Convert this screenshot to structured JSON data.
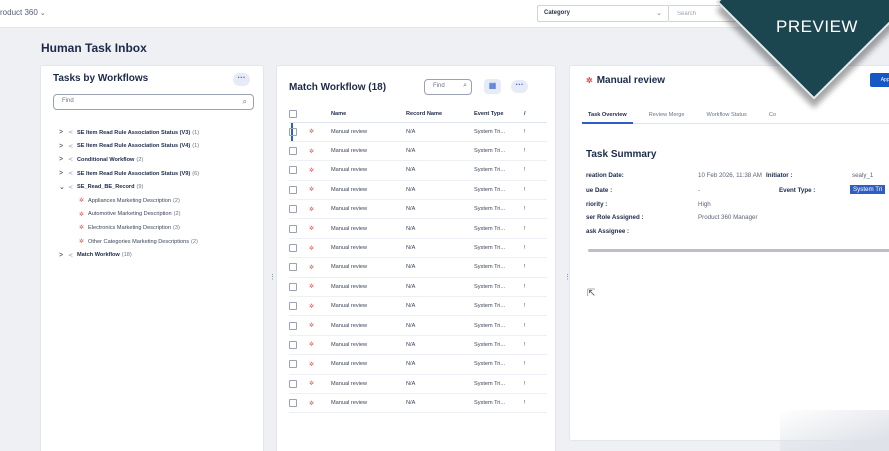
{
  "header": {
    "app_name": "roduct 360",
    "category_label": "Category",
    "search_placeholder": "Search"
  },
  "page_title": "Human Task Inbox",
  "left_panel": {
    "title": "Tasks by Workflows",
    "more_label": "···",
    "find_placeholder": "Find",
    "tree": [
      {
        "toggle": ">",
        "name": "SE Item Read Rule Association Status (V3)",
        "count": "(1)"
      },
      {
        "toggle": ">",
        "name": "SE Item Read Rule Association Status (V4)",
        "count": "(1)"
      },
      {
        "toggle": ">",
        "name": "Conditional Workflow",
        "count": "(2)"
      },
      {
        "toggle": ">",
        "name": "SE Item Read Rule Association Status (V9)",
        "count": "(6)"
      },
      {
        "toggle": "⌄",
        "name": "SE_Read_BE_Record",
        "count": "(9)"
      },
      {
        "child": true,
        "name": "Appliances Marketing Description",
        "count": "(2)"
      },
      {
        "child": true,
        "name": "Automotive Marketing Description",
        "count": "(2)"
      },
      {
        "child": true,
        "name": "Electronics Marketing Description",
        "count": "(3)"
      },
      {
        "child": true,
        "name": "Other Categories Marketing Descriptions",
        "count": "(2)"
      },
      {
        "toggle": ">",
        "name": "Match Workflow",
        "count": "(18)"
      }
    ]
  },
  "middle_panel": {
    "title": "Match Workflow (18)",
    "find_placeholder": "Find",
    "more_label": "···",
    "columns": [
      "Name",
      "Record Name",
      "Event Type"
    ],
    "rows": [
      {
        "name": "Manual review",
        "record": "N/A",
        "event": "System Tri...",
        "extra": "!"
      },
      {
        "name": "Manual review",
        "record": "N/A",
        "event": "System Tri...",
        "extra": "!"
      },
      {
        "name": "Manual review",
        "record": "N/A",
        "event": "System Tri...",
        "extra": "!"
      },
      {
        "name": "Manual review",
        "record": "N/A",
        "event": "System Tri...",
        "extra": "!"
      },
      {
        "name": "Manual review",
        "record": "N/A",
        "event": "System Tri...",
        "extra": "!"
      },
      {
        "name": "Manual review",
        "record": "N/A",
        "event": "System Tri...",
        "extra": "!"
      },
      {
        "name": "Manual review",
        "record": "N/A",
        "event": "System Tri...",
        "extra": "!"
      },
      {
        "name": "Manual review",
        "record": "N/A",
        "event": "System Tri...",
        "extra": "!"
      },
      {
        "name": "Manual review",
        "record": "N/A",
        "event": "System Tri...",
        "extra": "!"
      },
      {
        "name": "Manual review",
        "record": "N/A",
        "event": "System Tri...",
        "extra": "!"
      },
      {
        "name": "Manual review",
        "record": "N/A",
        "event": "System Tri...",
        "extra": "!"
      },
      {
        "name": "Manual review",
        "record": "N/A",
        "event": "System Tri...",
        "extra": "!"
      },
      {
        "name": "Manual review",
        "record": "N/A",
        "event": "System Tri...",
        "extra": "!"
      },
      {
        "name": "Manual review",
        "record": "N/A",
        "event": "System Tri...",
        "extra": "!"
      },
      {
        "name": "Manual review",
        "record": "N/A",
        "event": "System Tri...",
        "extra": "!"
      }
    ]
  },
  "right_panel": {
    "title": "Manual review",
    "approve_label": "Appr",
    "tabs": [
      "Task Overview",
      "Review Merge",
      "Workflow Status",
      "Co"
    ],
    "summary_title": "Task Summary",
    "fields": [
      {
        "key": "reation Date:",
        "value": "10 Feb 2026, 11:38 AM"
      },
      {
        "key": "ue Date :",
        "value": "-"
      },
      {
        "key": "riority :",
        "value": "High"
      },
      {
        "key": "ser Role Assigned :",
        "value": "Product 360 Manager"
      },
      {
        "key": "ask Assignee :",
        "value": ""
      }
    ],
    "initiator_key": "Initiator :",
    "initiator_value": "sealy_1",
    "event_type_key": "Event Type :",
    "event_type_value": "System Tri"
  },
  "ribbon": {
    "label": "PREVIEW"
  },
  "colors": {
    "accent": "#2d5dc6",
    "priority": "#d9534f",
    "ribbon": "#1b4650"
  }
}
